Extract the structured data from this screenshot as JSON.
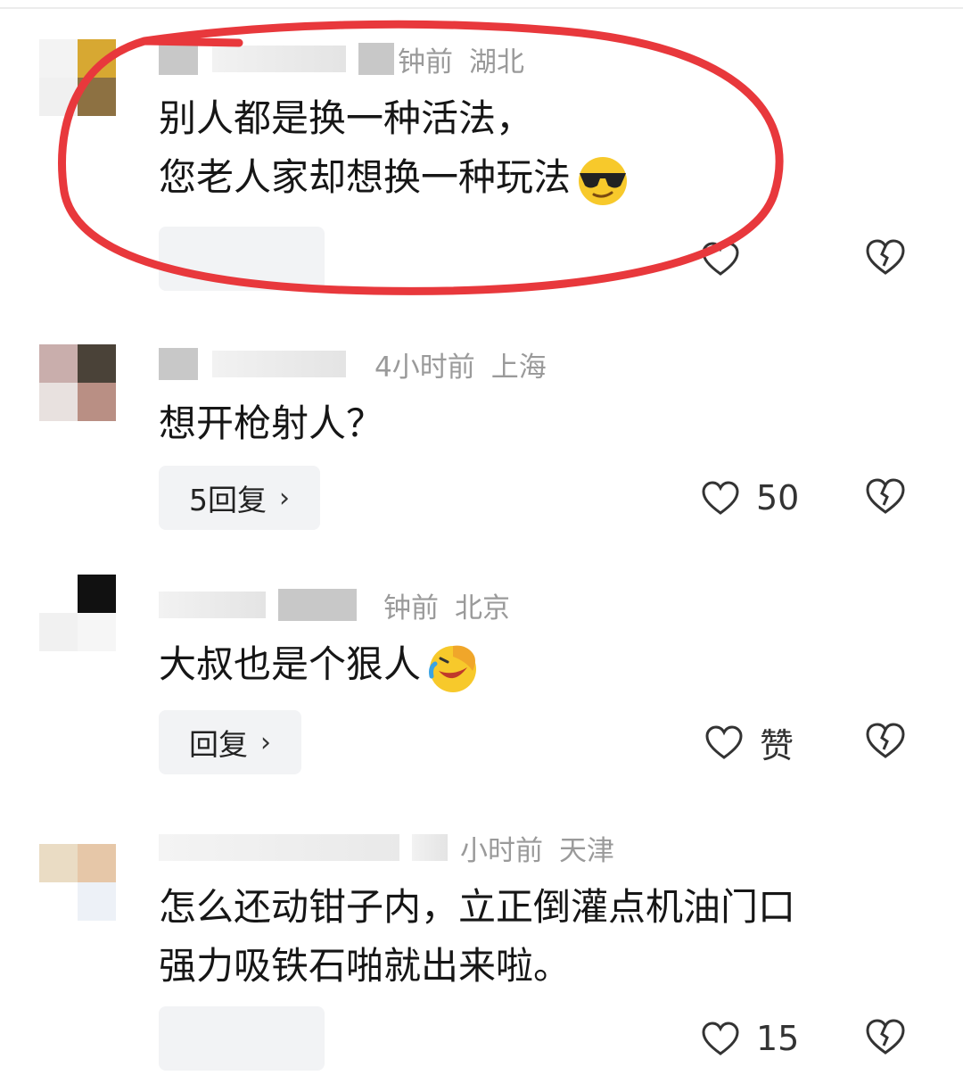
{
  "comments": [
    {
      "meta_time": "钟前",
      "meta_location": "湖北",
      "lines": [
        "别人都是换一种活法，",
        "您老人家却想换一种玩法"
      ],
      "emoji": "sunglasses-emoji",
      "reply_label": "",
      "like_count": ""
    },
    {
      "meta_time": "4小时前",
      "meta_location": "上海",
      "lines": [
        "想开枪射人？"
      ],
      "emoji": "",
      "reply_label": "5回复",
      "like_count": "50"
    },
    {
      "meta_time": "钟前",
      "meta_location": "北京",
      "lines": [
        "大叔也是个狠人"
      ],
      "emoji": "laughing-crying-emoji",
      "reply_label": "回复",
      "like_count": "赞"
    },
    {
      "meta_time": "小时前",
      "meta_location": "天津",
      "lines": [
        "怎么还动钳子内，立正倒灌点机油门口",
        "强力吸铁石啪就出来啦。"
      ],
      "emoji": "",
      "reply_label": "",
      "like_count": "15"
    }
  ],
  "icons": {
    "like": "heart-outline-icon",
    "dislike": "broken-heart-icon",
    "chevron": "›"
  },
  "colors": {
    "annotation": "#e8383c",
    "meta_text": "#9a9a9a",
    "pill_bg": "#f2f3f5"
  }
}
